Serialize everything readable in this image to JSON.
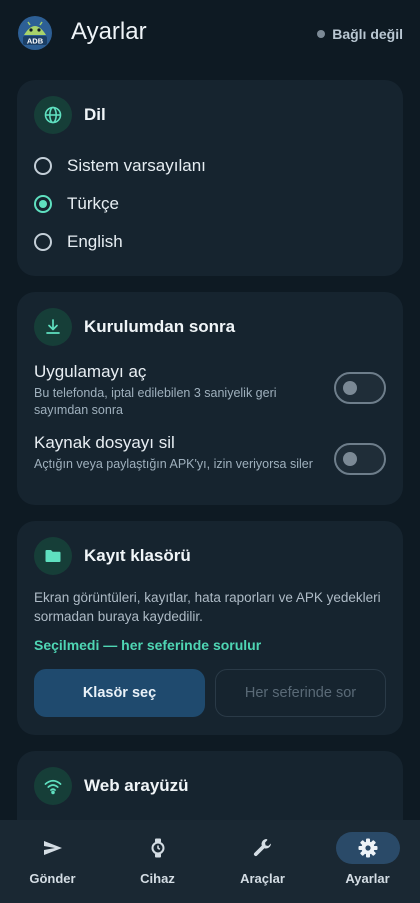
{
  "header": {
    "logo_text": "ADB",
    "title": "Ayarlar",
    "connection_status": "Bağlı değil"
  },
  "language_card": {
    "title": "Dil",
    "options": [
      {
        "label": "Sistem varsayılanı",
        "selected": false
      },
      {
        "label": "Türkçe",
        "selected": true
      },
      {
        "label": "English",
        "selected": false
      }
    ]
  },
  "post_install_card": {
    "title": "Kurulumdan sonra",
    "items": [
      {
        "title": "Uygulamayı aç",
        "description": "Bu telefonda, iptal edilebilen 3 saniyelik geri sayımdan sonra",
        "enabled": false
      },
      {
        "title": "Kaynak dosyayı sil",
        "description": "Açtığın veya paylaştığın APK'yı, izin veriyorsa siler",
        "enabled": false
      }
    ]
  },
  "folder_card": {
    "title": "Kayıt klasörü",
    "description": "Ekran görüntüleri, kayıtlar, hata raporları ve APK yedekleri sormadan buraya kaydedilir.",
    "status": "Seçilmedi — her seferinde sorulur",
    "choose_button": "Klasör seç",
    "ask_button": "Her seferinde sor"
  },
  "web_card": {
    "title": "Web arayüzü"
  },
  "bottom_nav": {
    "items": [
      {
        "label": "Gönder",
        "icon": "send-icon",
        "active": false
      },
      {
        "label": "Cihaz",
        "icon": "watch-icon",
        "active": false
      },
      {
        "label": "Araçlar",
        "icon": "wrench-icon",
        "active": false
      },
      {
        "label": "Ayarlar",
        "icon": "gear-icon",
        "active": true
      }
    ]
  },
  "colors": {
    "background": "#0e1a23",
    "card": "#16242f",
    "accent": "#4fd6b4",
    "primary_button": "#1f4a6e",
    "nav_active": "#2a4a68"
  }
}
